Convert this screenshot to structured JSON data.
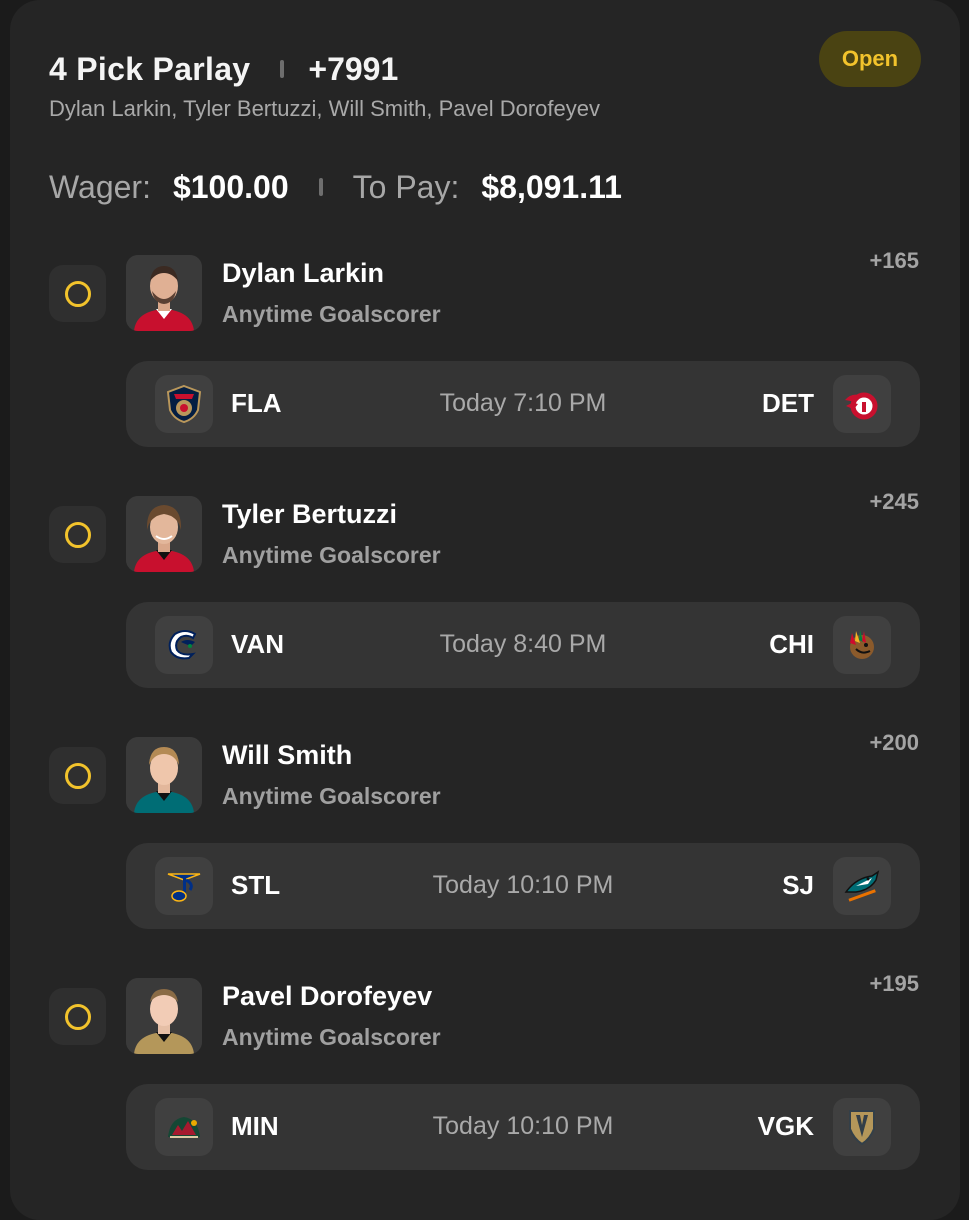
{
  "bet": {
    "title": "4 Pick Parlay",
    "total_odds": "+7991",
    "players_summary": "Dylan Larkin, Tyler Bertuzzi, Will Smith, Pavel Dorofeyev",
    "status": "Open",
    "wager_label": "Wager:",
    "wager_value": "$100.00",
    "to_pay_label": "To Pay:",
    "to_pay_value": "$8,091.11"
  },
  "picks": [
    {
      "player": "Dylan Larkin",
      "market": "Anytime Goalscorer",
      "odds": "+165",
      "jersey_color": "#c8102e",
      "away": "FLA",
      "home": "DET",
      "time": "Today 7:10 PM",
      "away_logo": "panthers-logo-icon",
      "home_logo": "red-wings-logo-icon"
    },
    {
      "player": "Tyler Bertuzzi",
      "market": "Anytime Goalscorer",
      "odds": "+245",
      "jersey_color": "#c8102e",
      "away": "VAN",
      "home": "CHI",
      "time": "Today 8:40 PM",
      "away_logo": "canucks-logo-icon",
      "home_logo": "blackhawks-logo-icon"
    },
    {
      "player": "Will Smith",
      "market": "Anytime Goalscorer",
      "odds": "+200",
      "jersey_color": "#006d75",
      "away": "STL",
      "home": "SJ",
      "time": "Today 10:10 PM",
      "away_logo": "blues-logo-icon",
      "home_logo": "sharks-logo-icon"
    },
    {
      "player": "Pavel Dorofeyev",
      "market": "Anytime Goalscorer",
      "odds": "+195",
      "jersey_color": "#b4975a",
      "away": "MIN",
      "home": "VGK",
      "time": "Today 10:10 PM",
      "away_logo": "wild-logo-icon",
      "home_logo": "golden-knights-logo-icon"
    }
  ],
  "colors": {
    "accent": "#f2c32c",
    "card_bg": "#252525",
    "game_bg": "#343434"
  }
}
